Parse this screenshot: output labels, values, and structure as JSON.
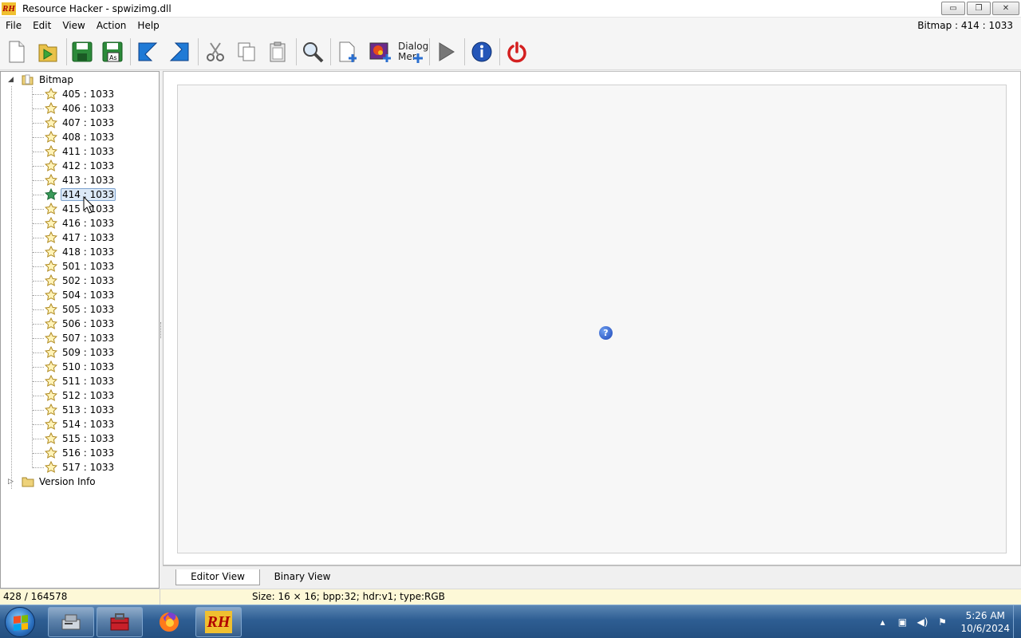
{
  "window": {
    "app_icon_text": "RH",
    "title": "Resource Hacker - spwizimg.dll",
    "minimize": "▭",
    "restore": "❐",
    "close": "✕"
  },
  "menu": {
    "items": [
      "File",
      "Edit",
      "View",
      "Action",
      "Help"
    ],
    "current_resource": "Bitmap : 414 : 1033"
  },
  "toolbar": {
    "dialog_line1": "Dialog",
    "dialog_line2": "Mer"
  },
  "tree": {
    "root_label": "Bitmap",
    "items": [
      "405 : 1033",
      "406 : 1033",
      "407 : 1033",
      "408 : 1033",
      "411 : 1033",
      "412 : 1033",
      "413 : 1033",
      "414 : 1033",
      "415 : 1033",
      "416 : 1033",
      "417 : 1033",
      "418 : 1033",
      "501 : 1033",
      "502 : 1033",
      "504 : 1033",
      "505 : 1033",
      "506 : 1033",
      "507 : 1033",
      "509 : 1033",
      "510 : 1033",
      "511 : 1033",
      "512 : 1033",
      "513 : 1033",
      "514 : 1033",
      "515 : 1033",
      "516 : 1033",
      "517 : 1033"
    ],
    "selected": "414 : 1033",
    "version_label": "Version Info"
  },
  "editor": {
    "help_badge": "?"
  },
  "tabs": {
    "editor": "Editor View",
    "binary": "Binary View"
  },
  "status": {
    "position": "428 / 164578",
    "info": "Size: 16 × 16;  bpp:32;  hdr:v1;  type:RGB"
  },
  "taskbar": {
    "rh_label": "RH",
    "time": "5:26 AM",
    "date": "10/6/2024"
  },
  "colors": {
    "selection": "#dce9f7",
    "status_bar": "#fdf8d7",
    "taskbar": "#2e5e93"
  }
}
